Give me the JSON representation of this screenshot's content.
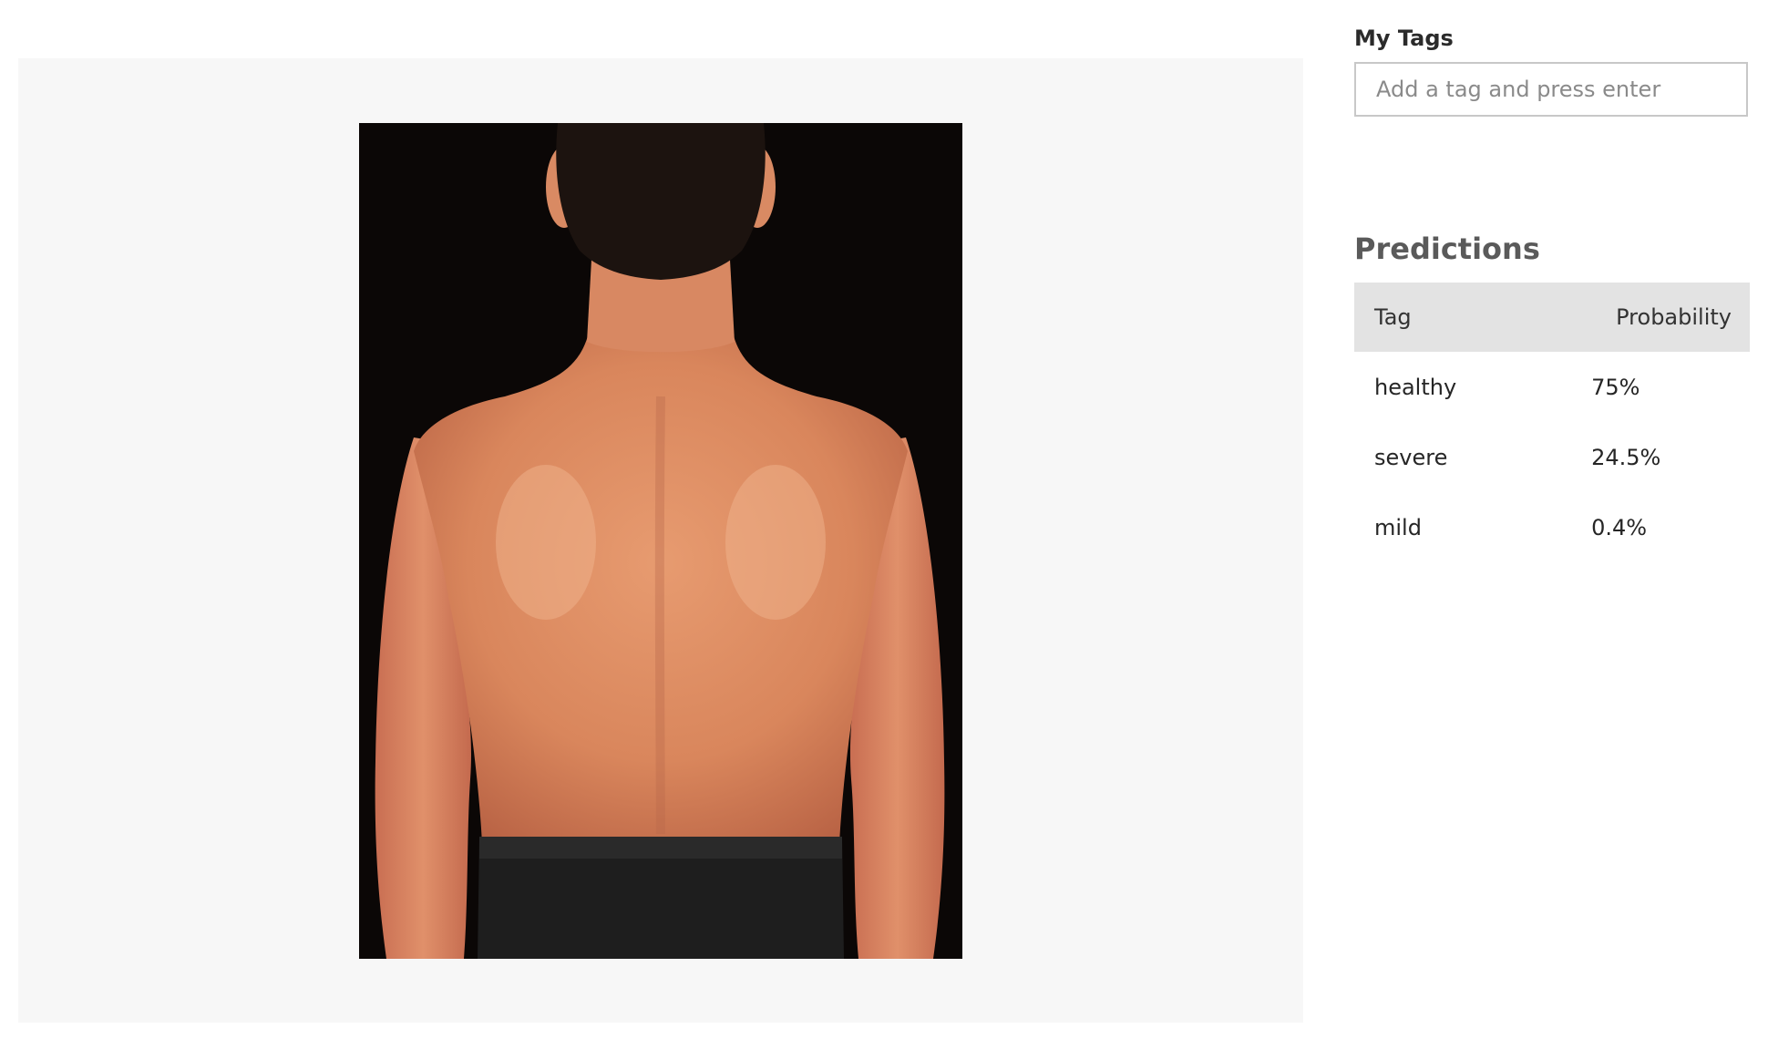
{
  "tags": {
    "label": "My Tags",
    "input_value": "",
    "placeholder": "Add a tag and press enter"
  },
  "predictions": {
    "title": "Predictions",
    "columns": {
      "tag": "Tag",
      "probability": "Probability"
    },
    "rows": [
      {
        "tag": "healthy",
        "probability": "75%"
      },
      {
        "tag": "severe",
        "probability": "24.5%"
      },
      {
        "tag": "mild",
        "probability": "0.4%"
      }
    ]
  },
  "colors": {
    "panel_bg": "#f7f7f7",
    "header_bg": "#e3e3e3",
    "photo_bg": "#0b0706",
    "skin": "#d9865c"
  }
}
